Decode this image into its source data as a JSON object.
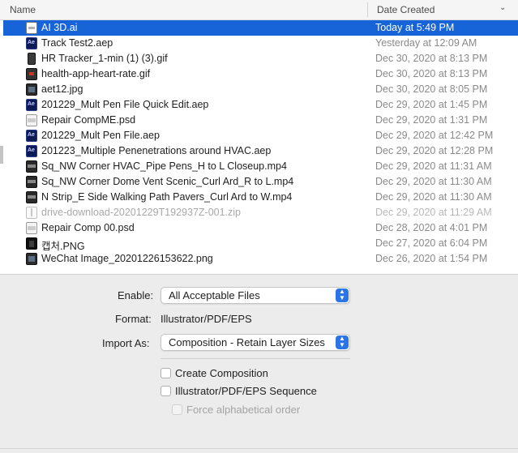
{
  "columns": {
    "name": "Name",
    "date_created": "Date Created"
  },
  "files": [
    {
      "name": "AI 3D.ai",
      "date": "Today at 5:49 PM",
      "icon": "ai-file-icon",
      "selected": true,
      "disabled": false
    },
    {
      "name": "Track Test2.aep",
      "date": "Yesterday at 12:09 AM",
      "icon": "aep-file-icon",
      "selected": false,
      "disabled": false
    },
    {
      "name": "HR Tracker_1-min (1) (3).gif",
      "date": "Dec 30, 2020 at 8:13 PM",
      "icon": "gif-file-icon",
      "selected": false,
      "disabled": false
    },
    {
      "name": "health-app-heart-rate.gif",
      "date": "Dec 30, 2020 at 8:13 PM",
      "icon": "gif-file-icon",
      "selected": false,
      "disabled": false
    },
    {
      "name": "aet12.jpg",
      "date": "Dec 30, 2020 at 8:05 PM",
      "icon": "image-file-icon",
      "selected": false,
      "disabled": false
    },
    {
      "name": "201229_Mult Pen File Quick Edit.aep",
      "date": "Dec 29, 2020 at 1:45 PM",
      "icon": "aep-file-icon",
      "selected": false,
      "disabled": false
    },
    {
      "name": "Repair CompME.psd",
      "date": "Dec 29, 2020 at 1:31 PM",
      "icon": "psd-file-icon",
      "selected": false,
      "disabled": false
    },
    {
      "name": "201229_Mult Pen File.aep",
      "date": "Dec 29, 2020 at 12:42 PM",
      "icon": "aep-file-icon",
      "selected": false,
      "disabled": false
    },
    {
      "name": "201223_Multiple Penenetrations around HVAC.aep",
      "date": "Dec 29, 2020 at 12:28 PM",
      "icon": "aep-file-icon",
      "selected": false,
      "disabled": false
    },
    {
      "name": "Sq_NW Corner HVAC_Pipe Pens_H to L Closeup.mp4",
      "date": "Dec 29, 2020 at 11:31 AM",
      "icon": "video-file-icon",
      "selected": false,
      "disabled": false
    },
    {
      "name": "Sq_NW Corner Dome Vent Scenic_Curl Ard_R to L.mp4",
      "date": "Dec 29, 2020 at 11:30 AM",
      "icon": "video-file-icon",
      "selected": false,
      "disabled": false
    },
    {
      "name": "N Strip_E Side Walking Path Pavers_Curl Ard to W.mp4",
      "date": "Dec 29, 2020 at 11:30 AM",
      "icon": "video-file-icon",
      "selected": false,
      "disabled": false
    },
    {
      "name": "drive-download-20201229T192937Z-001.zip",
      "date": "Dec 29, 2020 at 11:29 AM",
      "icon": "zip-file-icon",
      "selected": false,
      "disabled": true
    },
    {
      "name": "Repair Comp 00.psd",
      "date": "Dec 28, 2020 at 4:01 PM",
      "icon": "psd-file-icon",
      "selected": false,
      "disabled": false
    },
    {
      "name": "캡처.PNG",
      "date": "Dec 27, 2020 at 6:04 PM",
      "icon": "png-file-icon",
      "selected": false,
      "disabled": false
    },
    {
      "name": "WeChat Image_20201226153622.png",
      "date": "Dec 26, 2020 at 1:54 PM",
      "icon": "image-file-icon",
      "selected": false,
      "disabled": false
    }
  ],
  "options": {
    "enable_label": "Enable:",
    "enable_value": "All Acceptable Files",
    "format_label": "Format:",
    "format_value": "Illustrator/PDF/EPS",
    "import_as_label": "Import As:",
    "import_as_value": "Composition - Retain Layer Sizes",
    "create_composition": "Create Composition",
    "sequence": "Illustrator/PDF/EPS Sequence",
    "force_alpha": "Force alphabetical order"
  },
  "colors": {
    "selection": "#1764d8",
    "popup_arrow": "#2a74e6"
  }
}
